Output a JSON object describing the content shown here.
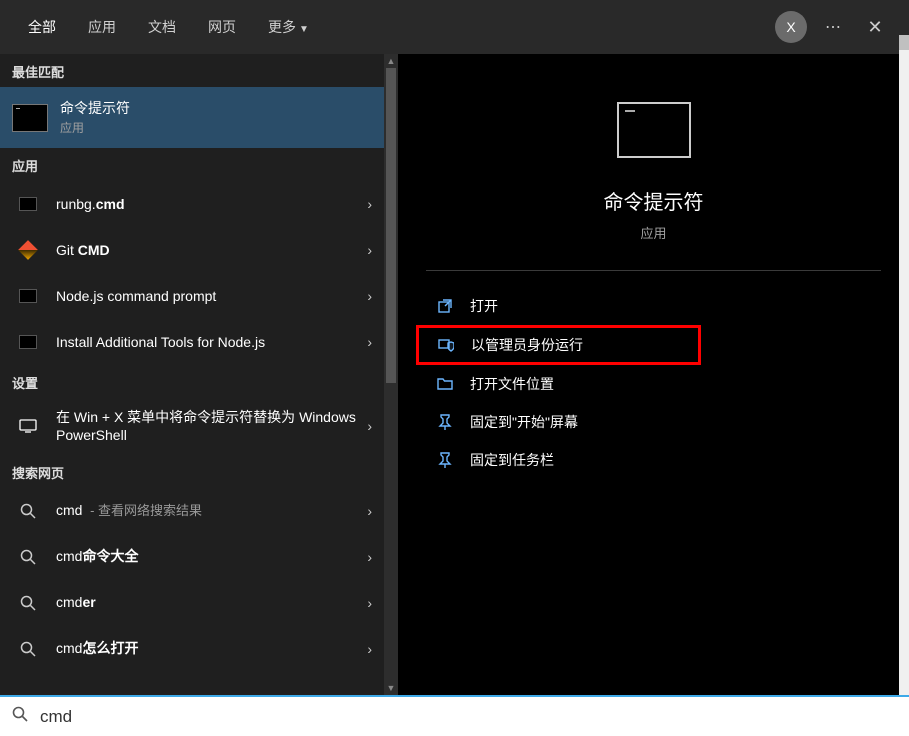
{
  "tabs": {
    "all": "全部",
    "apps": "应用",
    "docs": "文档",
    "web": "网页",
    "more": "更多"
  },
  "avatarInitial": "X",
  "sections": {
    "bestMatch": "最佳匹配",
    "apps": "应用",
    "settings": "设置",
    "searchWeb": "搜索网页"
  },
  "best": {
    "title": "命令提示符",
    "sub": "应用"
  },
  "appsList": [
    {
      "prefix": "runbg.",
      "bold": "cmd",
      "suffix": ""
    },
    {
      "prefix": "Git ",
      "bold": "CMD",
      "suffix": ""
    },
    {
      "prefix": "Node.js command prompt",
      "bold": "",
      "suffix": ""
    },
    {
      "prefix": "Install Additional Tools for Node.js",
      "bold": "",
      "suffix": ""
    }
  ],
  "settingsList": [
    {
      "text": "在 Win + X 菜单中将命令提示符替换为 Windows PowerShell"
    }
  ],
  "webList": [
    {
      "bold": "cmd",
      "tail": "",
      "sub": "查看网络搜索结果"
    },
    {
      "bold": "cmd",
      "tail": "命令大全",
      "sub": ""
    },
    {
      "bold": "cmd",
      "tail": "er",
      "sub": ""
    },
    {
      "bold": "cmd",
      "tail": "怎么打开",
      "sub": ""
    }
  ],
  "preview": {
    "title": "命令提示符",
    "sub": "应用"
  },
  "actions": {
    "open": "打开",
    "runAsAdmin": "以管理员身份运行",
    "openLocation": "打开文件位置",
    "pinStart": "固定到\"开始\"屏幕",
    "pinTaskbar": "固定到任务栏"
  },
  "search": {
    "value": "cmd"
  }
}
